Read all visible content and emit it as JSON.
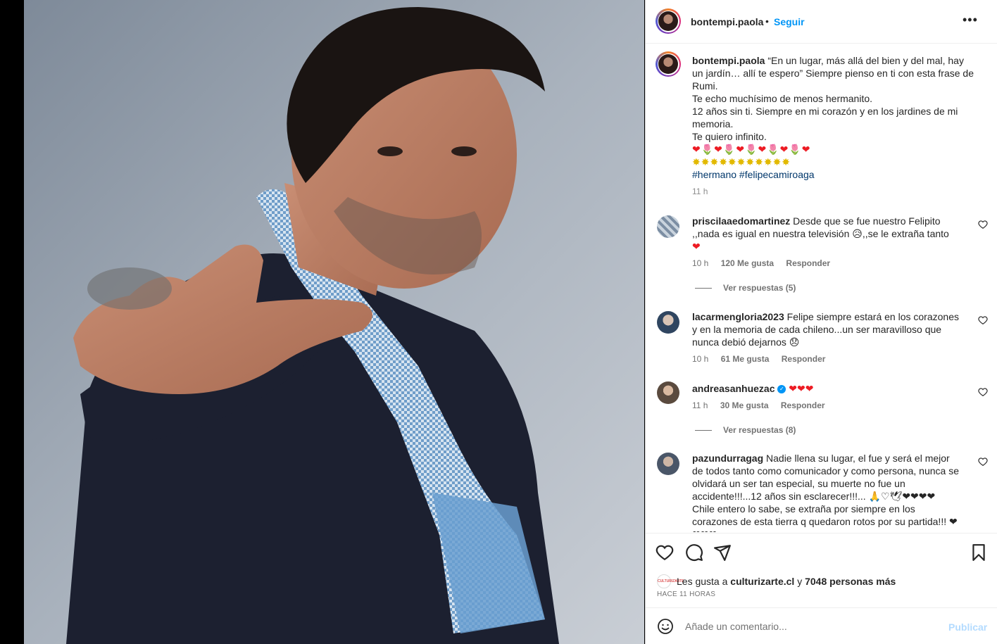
{
  "post": {
    "username": "bontempi.paola",
    "dot": "•",
    "follow_label": "Seguir",
    "more_label": "•••"
  },
  "caption": {
    "username": "bontempi.paola",
    "line1": "“En un lugar, más allá del bien y del mal, hay un jardín… allí te espero” Siempre pienso en ti con esta frase de Rumi.",
    "line2": "Te echo muchísimo de menos hermanito.",
    "line3": "12 años sin ti. Siempre en mi corazón y en los jardines de mi memoria.",
    "line4": "Te quiero infinito.",
    "emoji_row1": "❤🌷❤🌷❤🌷❤🌷❤🌷❤",
    "emoji_row2": "✸✸✸✸✸✸✸✸✸✸✸",
    "hashtags": "#hermano #felipecamiroaga",
    "time": "11 h"
  },
  "comments": [
    {
      "username": "priscilaaedomartinez",
      "text": "Desde que se fue nuestro Felipito ,,nada es igual en nuestra televisión 😥,,se le extraña tanto",
      "emoji": "❤",
      "time": "10 h",
      "likes": "120 Me gusta",
      "reply": "Responder",
      "view_replies": "Ver respuestas (5)"
    },
    {
      "username": "lacarmengloria2023",
      "text": "Felipe siempre estará en los corazones y en la memoria de cada chileno...un ser maravilloso que nunca debió dejarnos 😞",
      "time": "10 h",
      "likes": "61 Me gusta",
      "reply": "Responder"
    },
    {
      "username": "andreasanhuezac",
      "verified": "✓",
      "text": "❤❤❤",
      "time": "11 h",
      "likes": "30 Me gusta",
      "reply": "Responder",
      "view_replies": "Ver respuestas (8)"
    },
    {
      "username": "pazundurragag",
      "text": "Nadie llena su lugar, el fue y será el mejor de todos tanto como comunicador y como persona, nunca se olvidará un ser tan especial, su muerte no fue un accidente!!!...12 años sin esclarecer!!!... 🙏♡🕊❤❤❤❤ Chile entero lo sabe, se extraña por siempre en los corazones de esta tierra q quedaron rotos por su partida!!! ❤❤❤❤"
    }
  ],
  "likes": {
    "avatar_text": "CULTURIZARTE",
    "prefix": "Les gusta a",
    "user": "culturizarte.cl",
    "middle": "y",
    "count": "7048 personas más"
  },
  "when": "HACE 11 HORAS",
  "add_comment": {
    "placeholder": "Añade un comentario...",
    "post_label": "Publicar"
  },
  "icons": [
    "heart-icon",
    "comment-icon",
    "share-icon",
    "bookmark-icon",
    "emoji-icon",
    "more-icon"
  ]
}
